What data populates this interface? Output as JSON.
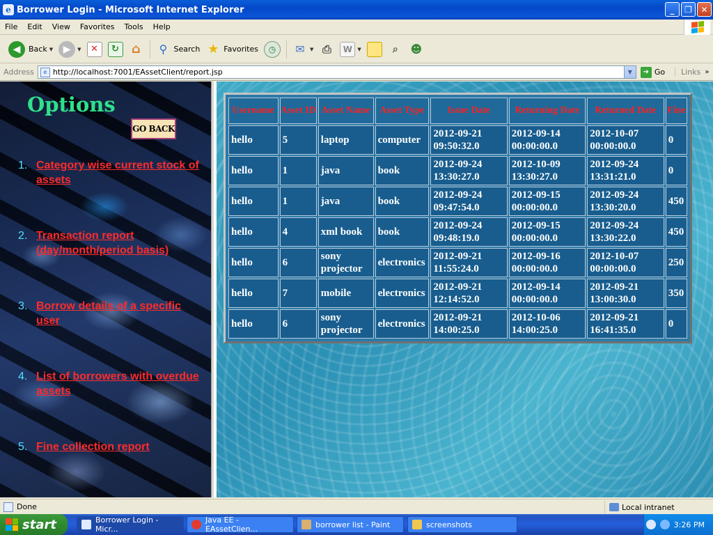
{
  "window": {
    "title": "Borrower Login - Microsoft Internet Explorer",
    "controls": [
      "_",
      "❐",
      "✕"
    ]
  },
  "menu": [
    "File",
    "Edit",
    "View",
    "Favorites",
    "Tools",
    "Help"
  ],
  "toolbar": {
    "back": "Back",
    "search": "Search",
    "favorites": "Favorites"
  },
  "address": {
    "label": "Address",
    "url": "http://localhost:7001/EAssetClient/report.jsp",
    "go": "Go",
    "links": "Links"
  },
  "left": {
    "title": "Options",
    "goback": "GO BACK",
    "options": [
      {
        "num": "1.",
        "label": "Category wise current stock of assets"
      },
      {
        "num": "2.",
        "label": "Transaction report (day/month/period basis)"
      },
      {
        "num": "3.",
        "label": "Borrow details of a specific user"
      },
      {
        "num": "4.",
        "label": "List of borrowers with overdue assets"
      },
      {
        "num": "5.",
        "label": "Fine collection report"
      }
    ]
  },
  "table": {
    "headers": [
      "Username",
      "Asset ID",
      "Asset Name",
      "Asset Type",
      "Issue Date",
      "Returning Date",
      "Returned Date",
      "Fine"
    ],
    "rows": [
      [
        "hello",
        "5",
        "laptop",
        "computer",
        "2012-09-21 09:50:32.0",
        "2012-09-14 00:00:00.0",
        "2012-10-07 00:00:00.0",
        "0"
      ],
      [
        "hello",
        "1",
        "java",
        "book",
        "2012-09-24 13:30:27.0",
        "2012-10-09 13:30:27.0",
        "2012-09-24 13:31:21.0",
        "0"
      ],
      [
        "hello",
        "1",
        "java",
        "book",
        "2012-09-24 09:47:54.0",
        "2012-09-15 00:00:00.0",
        "2012-09-24 13:30:20.0",
        "450"
      ],
      [
        "hello",
        "4",
        "xml book",
        "book",
        "2012-09-24 09:48:19.0",
        "2012-09-15 00:00:00.0",
        "2012-09-24 13:30:22.0",
        "450"
      ],
      [
        "hello",
        "6",
        "sony projector",
        "electronics",
        "2012-09-21 11:55:24.0",
        "2012-09-16 00:00:00.0",
        "2012-10-07 00:00:00.0",
        "250"
      ],
      [
        "hello",
        "7",
        "mobile",
        "electronics",
        "2012-09-21 12:14:52.0",
        "2012-09-14 00:00:00.0",
        "2012-09-21 13:00:30.0",
        "350"
      ],
      [
        "hello",
        "6",
        "sony projector",
        "electronics",
        "2012-09-21 14:00:25.0",
        "2012-10-06 14:00:25.0",
        "2012-09-21 16:41:35.0",
        "0"
      ]
    ]
  },
  "status": {
    "text": "Done",
    "zone": "Local intranet"
  },
  "taskbar": {
    "start": "start",
    "tasks": [
      "Borrower Login - Micr...",
      "Java EE - EAssetClien...",
      "borrower list - Paint",
      "screenshots"
    ],
    "clock": "3:26 PM"
  }
}
